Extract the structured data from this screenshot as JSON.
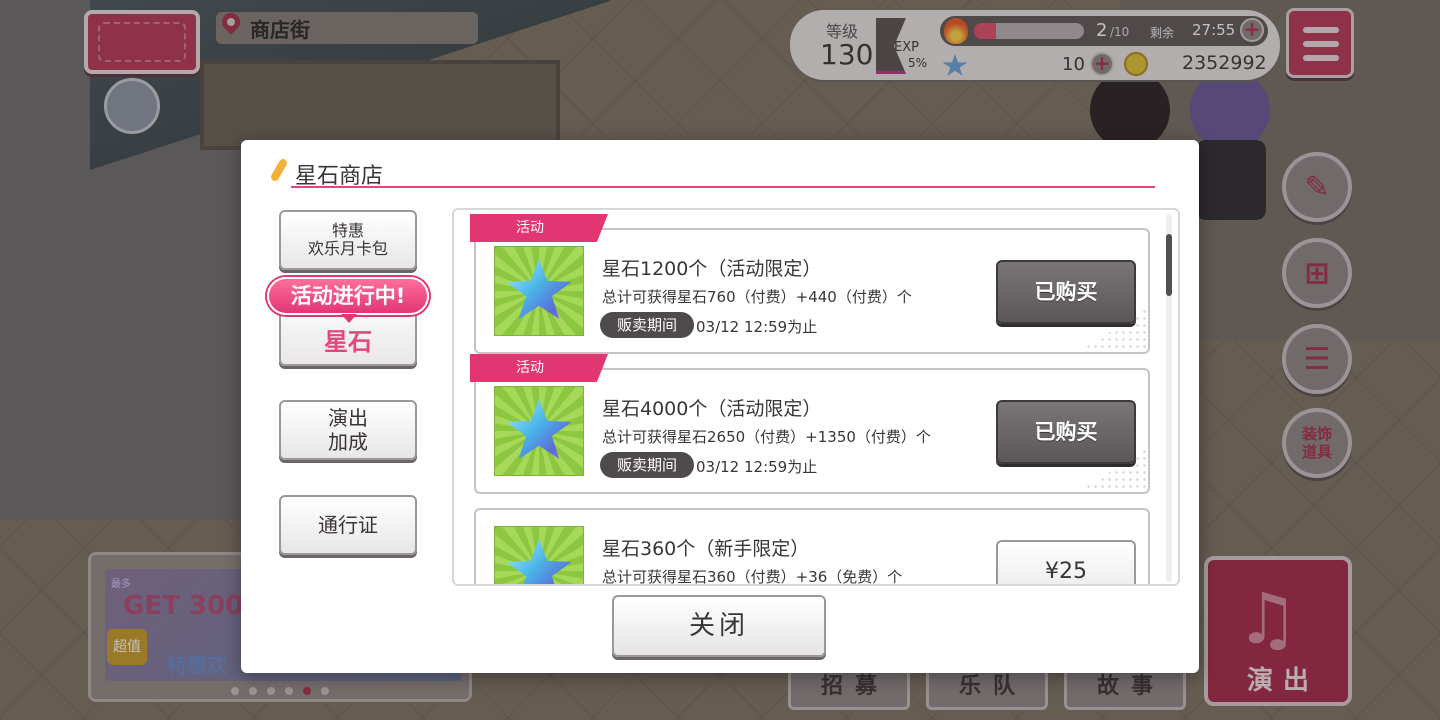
{
  "location": {
    "name": "商店街"
  },
  "status": {
    "level_label": "等级",
    "level": "130",
    "exp_label": "EXP",
    "exp_percent": "5%",
    "exp_fraction": 0.05,
    "stamina": "2",
    "stamina_max": "/10",
    "stamina_fraction": 0.2,
    "remaining_label": "剩余",
    "timer": "27:55",
    "star_gems": "10",
    "coins": "2352992",
    "plus": "+"
  },
  "side_buttons": {
    "deco_label": "装饰\n道具"
  },
  "banner": {
    "small_text": "最多",
    "main_text": "GET 300",
    "tag": "超值",
    "sub_text": "特惠欢"
  },
  "nav": {
    "recruit": "招募",
    "band": "乐队",
    "story": "故事",
    "live": "演出"
  },
  "modal": {
    "title": "星石商店",
    "tabs": {
      "monthly_pack": "特惠\n欢乐月卡包",
      "event_badge": "活动进行中!",
      "star_stone": "星石",
      "live_boost": "演出\n加成",
      "pass": "通行证"
    },
    "products": [
      {
        "tag": "活动",
        "name": "星石1200个（活动限定）",
        "desc": "总计可获得星石760（付费）+440（付费）个",
        "period_label": "贩卖期间",
        "period": "03/12 12:59为止",
        "button": "已购买"
      },
      {
        "tag": "活动",
        "name": "星石4000个（活动限定）",
        "desc": "总计可获得星石2650（付费）+1350（付费）个",
        "period_label": "贩卖期间",
        "period": "03/12 12:59为止",
        "button": "已购买"
      },
      {
        "name": "星石360个（新手限定）",
        "desc": "总计可获得星石360（付费）+36（免费）个",
        "button": "¥25"
      }
    ],
    "close": "关闭"
  },
  "colors": {
    "accent_pink": "#e23673",
    "title_line": "#e5457a",
    "brand_red": "#b63a5b",
    "purchased_gray": "#5b5758"
  },
  "icons": [
    "map-icon",
    "pin-icon",
    "flame-icon",
    "star-gem-icon",
    "coin-icon",
    "plus-icon",
    "menu-icon",
    "pen-icon",
    "gift-icon",
    "checklist-icon",
    "music-note-icon"
  ]
}
